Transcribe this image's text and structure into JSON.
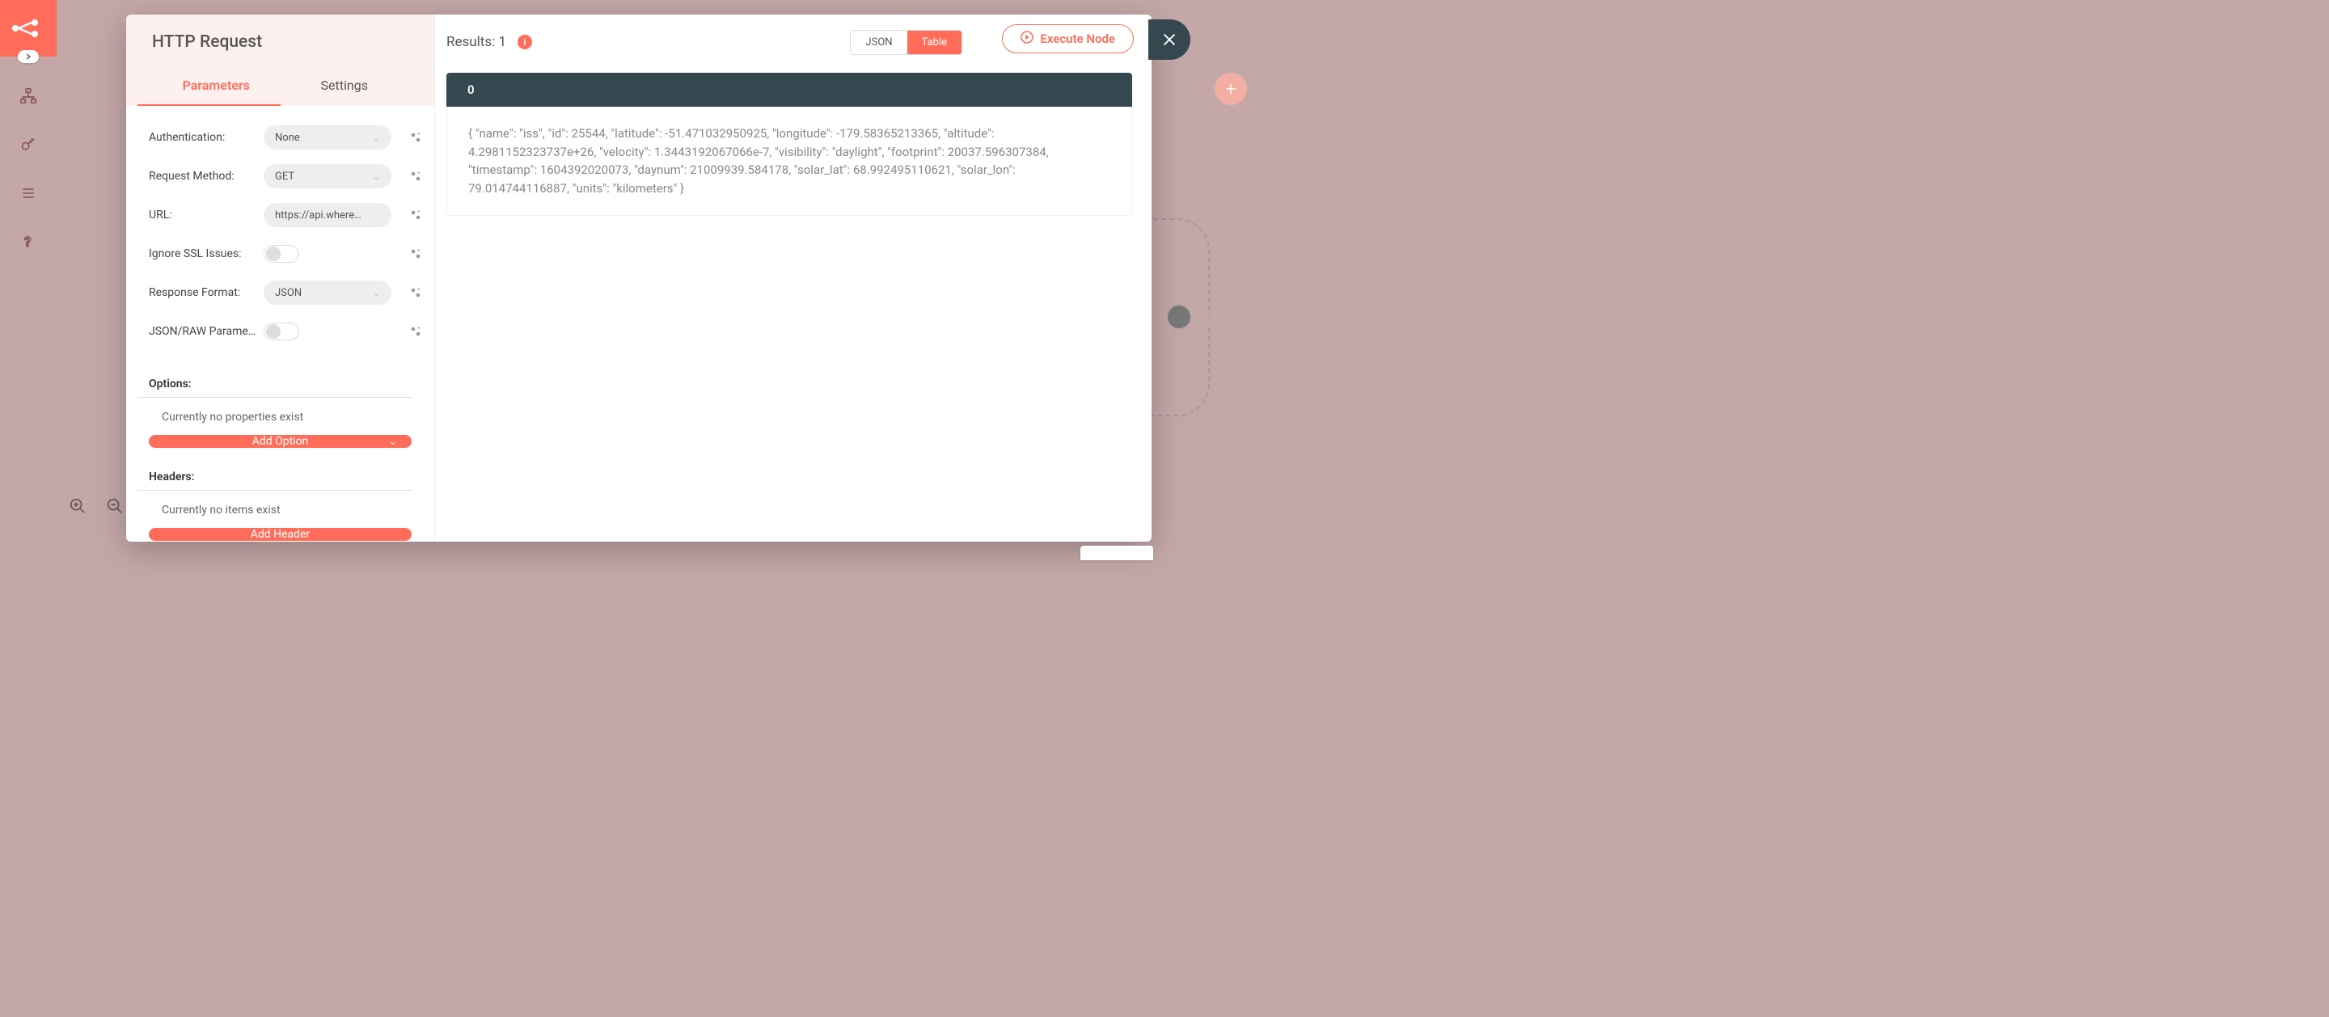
{
  "sidebar": {
    "icons": [
      "workflows-icon",
      "credentials-icon",
      "executions-icon",
      "help-icon"
    ]
  },
  "canvas": {
    "zoom_in": "+",
    "zoom_out": "−",
    "add_node_label": "+"
  },
  "node": {
    "title": "HTTP Request",
    "tabs": {
      "parameters": "Parameters",
      "settings": "Settings"
    },
    "params": {
      "authentication": {
        "label": "Authentication:",
        "value": "None"
      },
      "request_method": {
        "label": "Request Method:",
        "value": "GET"
      },
      "url": {
        "label": "URL:",
        "value": "https://api.where…"
      },
      "ignore_ssl": {
        "label": "Ignore SSL Issues:"
      },
      "response_format": {
        "label": "Response Format:",
        "value": "JSON"
      },
      "json_raw": {
        "label": "JSON/RAW Parame…"
      }
    },
    "options": {
      "title": "Options:",
      "empty": "Currently no properties exist",
      "add_button": "Add Option"
    },
    "headers": {
      "title": "Headers:",
      "empty": "Currently no items exist",
      "add_button": "Add Header"
    }
  },
  "results": {
    "label": "Results: 1",
    "view_json": "JSON",
    "view_table": "Table",
    "execute": "Execute Node",
    "col_header": "0",
    "cell": "{ \"name\": \"iss\", \"id\": 25544, \"latitude\": -51.471032950925, \"longitude\": -179.58365213365, \"altitude\": 4.2981152323737e+26, \"velocity\": 1.3443192067066e-7, \"visibility\": \"daylight\", \"footprint\": 20037.596307384, \"timestamp\": 1604392020073, \"daynum\": 21009939.584178, \"solar_lat\": 68.992495110621, \"solar_lon\": 79.014744116887, \"units\": \"kilometers\" }"
  }
}
